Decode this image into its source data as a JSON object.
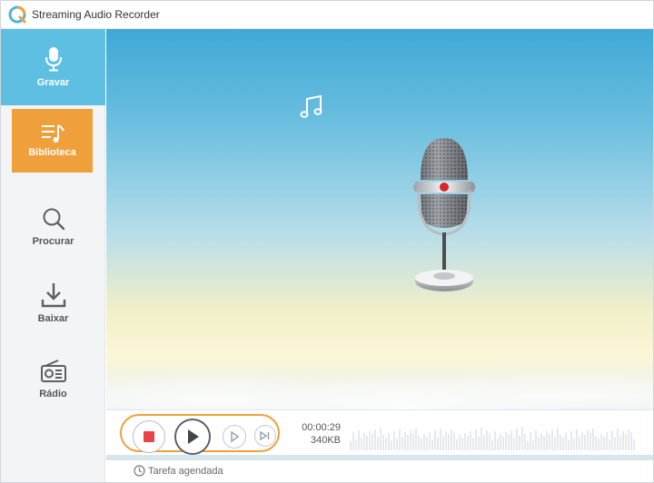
{
  "window": {
    "title": "Streaming Audio Recorder"
  },
  "sidebar": {
    "items": [
      {
        "label": "Gravar",
        "icon": "microphone-icon",
        "active_color": "#5fbfe3"
      },
      {
        "label": "Biblioteca",
        "icon": "library-icon",
        "selected_color": "#f0a03a"
      },
      {
        "label": "Procurar",
        "icon": "search-icon"
      },
      {
        "label": "Baixar",
        "icon": "download-icon"
      },
      {
        "label": "Rádio",
        "icon": "radio-icon"
      }
    ]
  },
  "player": {
    "time": "00:00:29",
    "size": "340KB",
    "accent_color": "#f0a03a",
    "stop_color": "#e8434a"
  },
  "footer": {
    "scheduled_task": "Tarefa agendada"
  }
}
